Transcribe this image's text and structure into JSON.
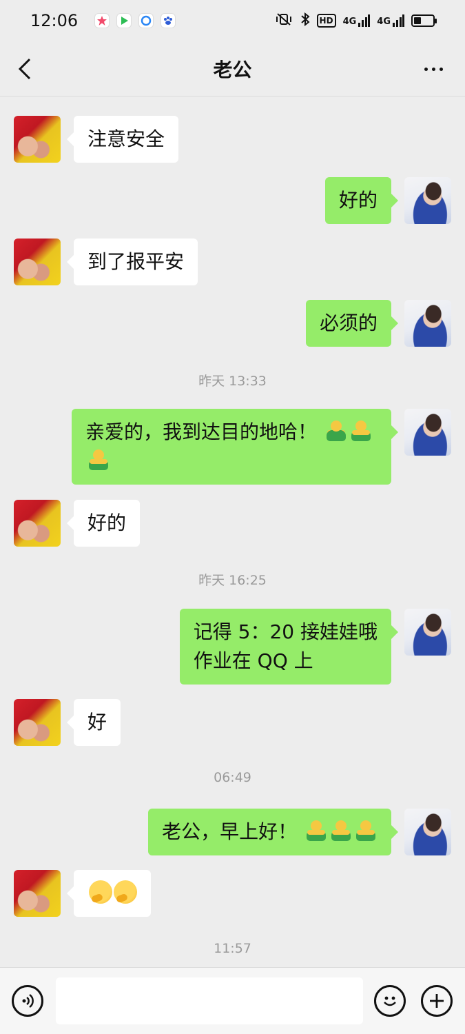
{
  "status": {
    "time": "12:06",
    "apps": [
      "star-app-icon",
      "video-app-icon",
      "browser-app-icon",
      "baidu-app-icon"
    ],
    "network_1": "4G",
    "network_2": "4G",
    "hd": "HD",
    "battery_level": 0.4
  },
  "header": {
    "title": "老公",
    "back_icon": "chevron-left-icon",
    "more_icon": "more-dots-icon"
  },
  "messages": [
    {
      "side": "in",
      "text": "注意安全"
    },
    {
      "side": "out",
      "text": "好的"
    },
    {
      "side": "in",
      "text": "到了报平安"
    },
    {
      "side": "out",
      "text": "必须的"
    },
    {
      "type": "time",
      "text": "昨天 13:33"
    },
    {
      "side": "out",
      "line1": "亲爱的，我到达目的地哈！",
      "emoji": "hug-emoji"
    },
    {
      "side": "in",
      "text": "好的"
    },
    {
      "type": "time",
      "text": "昨天 16:25"
    },
    {
      "side": "out",
      "line1": "记得 5：20 接娃娃哦",
      "line2": "作业在 QQ 上"
    },
    {
      "side": "in",
      "text": "好"
    },
    {
      "type": "time",
      "text": "06:49"
    },
    {
      "side": "out",
      "text": "老公，早上好！",
      "emoji": "hug-emoji"
    },
    {
      "side": "in",
      "emoji": "thinking-emoji"
    },
    {
      "type": "time",
      "text": "11:57"
    }
  ],
  "input": {
    "placeholder": "",
    "voice_icon": "voice-icon",
    "emoji_icon": "emoji-icon",
    "plus_icon": "plus-icon"
  },
  "colors": {
    "background": "#ededed",
    "outgoing_bubble": "#95ec69",
    "incoming_bubble": "#ffffff",
    "timestamp": "#9a9a9a"
  }
}
